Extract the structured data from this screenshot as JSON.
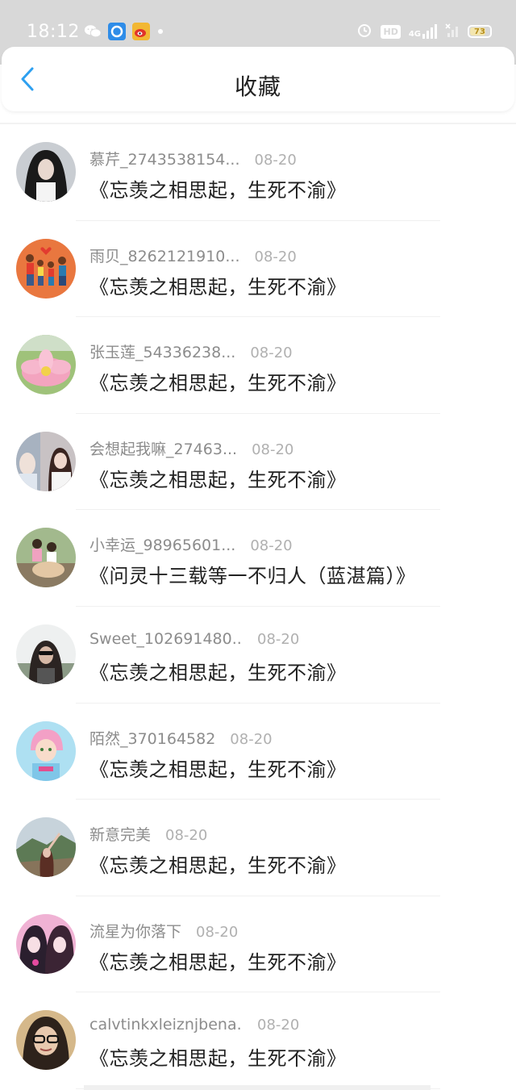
{
  "status_bar": {
    "time": "18:12",
    "battery": "73",
    "battery_level": 0.73,
    "network_label": "4G",
    "hd_label": "HD",
    "icons": [
      "wechat-icon",
      "browser-icon",
      "weibo-icon",
      "alarm-icon",
      "signal-icon",
      "battery-icon"
    ]
  },
  "header": {
    "title": "收藏",
    "back_icon": "chevron-left-icon",
    "accent_color": "#2ea0f0"
  },
  "items": [
    {
      "username": "慕芹_2743538154...",
      "date": "08-20",
      "title": "《忘羡之相思起，生死不渝》",
      "avatar": "avatar-girl-dark-hair"
    },
    {
      "username": "雨贝_8262121910...",
      "date": "08-20",
      "title": "《忘羡之相思起，生死不渝》",
      "avatar": "avatar-family-cartoon"
    },
    {
      "username": "张玉莲_54336238...",
      "date": "08-20",
      "title": "《忘羡之相思起，生死不渝》",
      "avatar": "avatar-lotus-flower"
    },
    {
      "username": "会想起我嘛_27463...",
      "date": "08-20",
      "title": "《忘羡之相思起，生死不渝》",
      "avatar": "avatar-girls-photo"
    },
    {
      "username": "小幸运_98965601...",
      "date": "08-20",
      "title": "《问灵十三载等一不归人（蓝湛篇）》",
      "avatar": "avatar-kids-outdoor"
    },
    {
      "username": "Sweet_102691480...",
      "date": "08-20",
      "title": "《忘羡之相思起，生死不渝》",
      "avatar": "avatar-woman-sunglasses"
    },
    {
      "username": "陌然_370164582",
      "date": "08-20",
      "title": "《忘羡之相思起，生死不渝》",
      "avatar": "avatar-anime-character"
    },
    {
      "username": "新意完美",
      "date": "08-20",
      "title": "《忘羡之相思起，生死不渝》",
      "avatar": "avatar-mountain-girl"
    },
    {
      "username": "流星为你落下",
      "date": "08-20",
      "title": "《忘羡之相思起，生死不渝》",
      "avatar": "avatar-anime-girls-pink"
    },
    {
      "username": "calvtinkxleiznjbena...",
      "date": "08-20",
      "title": "《忘羡之相思起，生死不渝》",
      "avatar": "avatar-woman-glasses"
    }
  ]
}
